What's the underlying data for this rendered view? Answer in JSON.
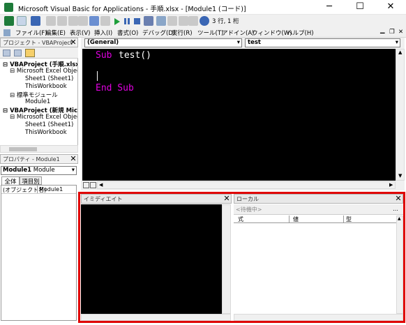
{
  "title": "Microsoft Visual Basic for Applications - 手順.xlsx - [Module1 (コード)]",
  "window_controls": {
    "minimize": "─",
    "maximize": "☐",
    "close": "✕"
  },
  "toolbar": {
    "position": "3 行, 1 桁"
  },
  "menu": [
    "ファイル(F)",
    "編集(E)",
    "表示(V)",
    "挿入(I)",
    "書式(O)",
    "デバッグ(D)",
    "実行(R)",
    "ツール(T)",
    "アドイン(A)",
    "ウィンドウ(W)",
    "ヘルプ(H)"
  ],
  "project": {
    "title": "プロジェクト - VBAProject",
    "tree": [
      {
        "label": "VBAProject (手順.xlsx)",
        "level": 0,
        "bold": true
      },
      {
        "label": "Microsoft Excel Objects",
        "level": 1
      },
      {
        "label": "Sheet1 (Sheet1)",
        "level": 2
      },
      {
        "label": "ThisWorkbook",
        "level": 2
      },
      {
        "label": "標準モジュール",
        "level": 1
      },
      {
        "label": "Module1",
        "level": 2
      },
      {
        "label": "VBAProject (新規 Microsoft...)",
        "level": 0,
        "bold": true
      },
      {
        "label": "Microsoft Excel Objects",
        "level": 1
      },
      {
        "label": "Sheet1 (Sheet1)",
        "level": 2
      },
      {
        "label": "ThisWorkbook",
        "level": 2
      }
    ]
  },
  "properties": {
    "title": "プロパティ - Module1",
    "object": "Module1",
    "object_type": "Module",
    "tabs": [
      "全体",
      "項目別"
    ],
    "row_name": "(オブジェクト名)",
    "row_value": "Module1"
  },
  "code": {
    "object_combo": "(General)",
    "proc_combo": "test",
    "line1_kw": "Sub",
    "line1_name": "test()",
    "line3": "End Sub"
  },
  "immediate": {
    "title": "イミディエイト"
  },
  "locals": {
    "title": "ローカル",
    "status": "<待機中>",
    "columns": [
      "式",
      "値",
      "型"
    ]
  },
  "colors": {
    "highlight_border": "#e00000",
    "keyword": "#e000e0",
    "code_bg": "#000000"
  }
}
